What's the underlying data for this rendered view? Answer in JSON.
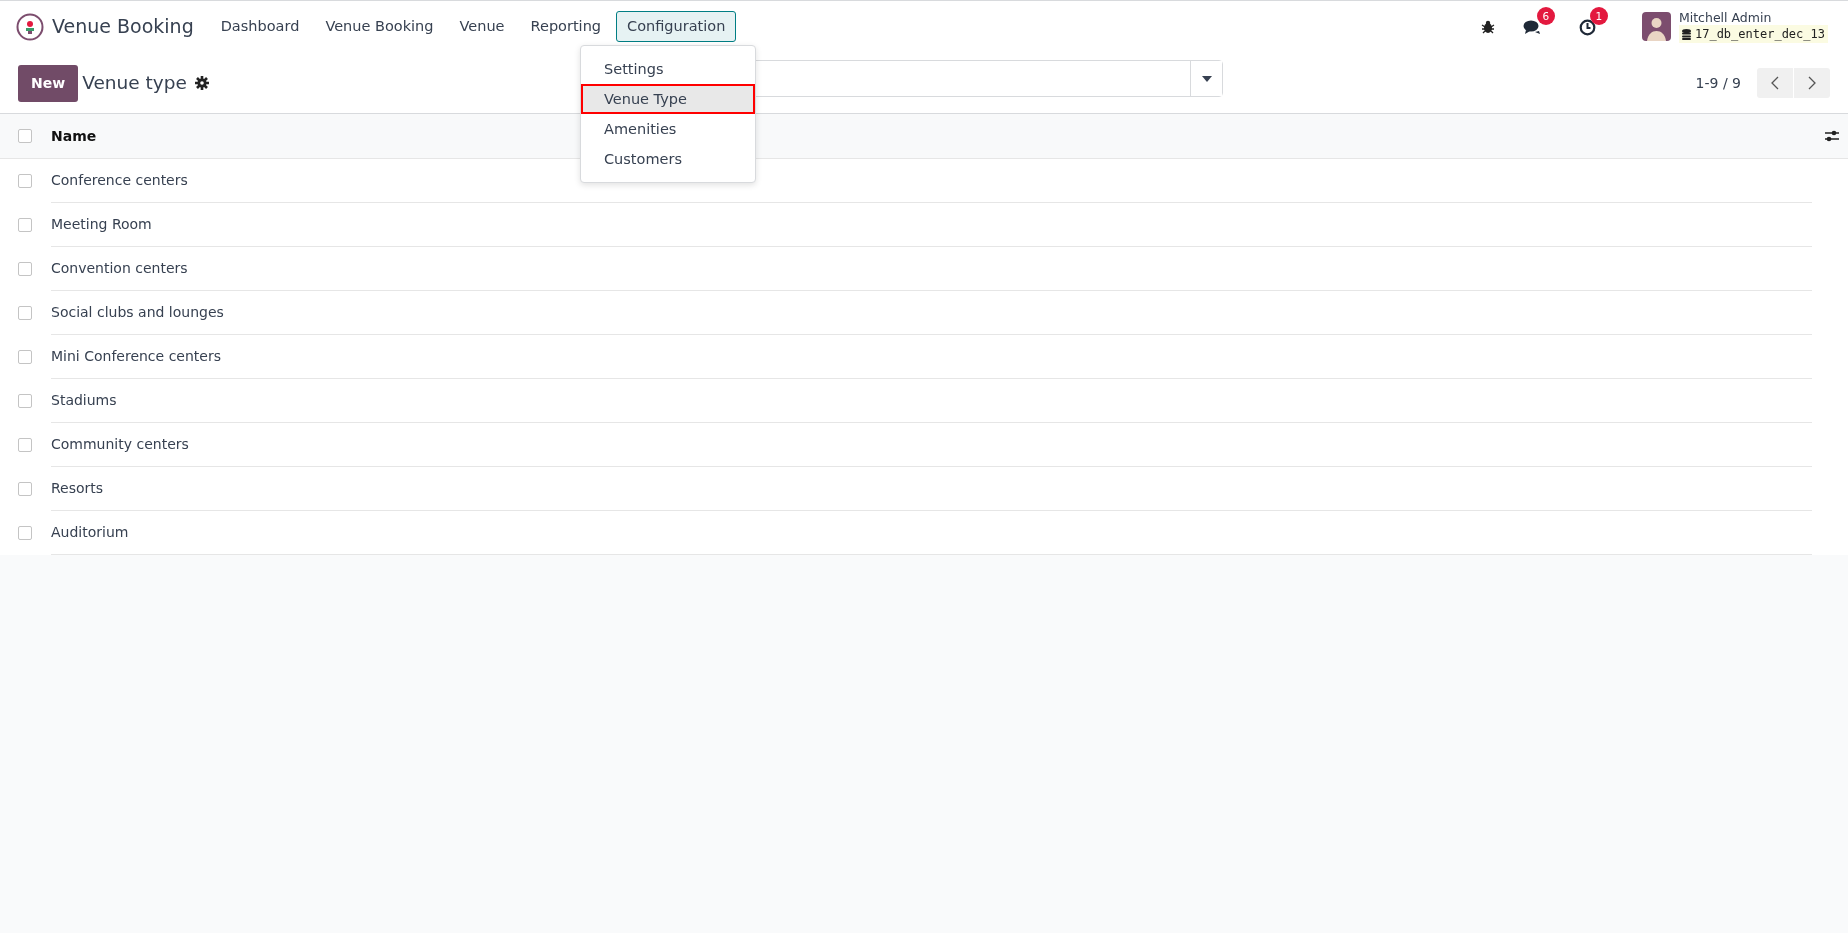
{
  "navbar": {
    "app_name": "Venue Booking",
    "menus": [
      {
        "label": "Dashboard",
        "selected": false
      },
      {
        "label": "Venue Booking",
        "selected": false
      },
      {
        "label": "Venue",
        "selected": false
      },
      {
        "label": "Reporting",
        "selected": false
      },
      {
        "label": "Configuration",
        "selected": true
      }
    ],
    "messages_badge": "6",
    "activities_badge": "1",
    "user_name": "Mitchell Admin",
    "database": "17_db_enter_dec_13"
  },
  "dropdown": {
    "items": [
      {
        "label": "Settings",
        "selected": false
      },
      {
        "label": "Venue Type",
        "selected": true
      },
      {
        "label": "Amenities",
        "selected": false
      },
      {
        "label": "Customers",
        "selected": false
      }
    ]
  },
  "control_panel": {
    "new_button": "New",
    "title": "Venue type",
    "pager": "1-9 / 9"
  },
  "table": {
    "columns": [
      {
        "label": "Name"
      }
    ],
    "header_checked": false,
    "rows": [
      {
        "name": "Conference centers",
        "checked": false
      },
      {
        "name": "Meeting Room",
        "checked": false
      },
      {
        "name": "Convention centers",
        "checked": false
      },
      {
        "name": "Social clubs and lounges",
        "checked": false
      },
      {
        "name": "Mini Conference centers",
        "checked": false
      },
      {
        "name": "Stadiums",
        "checked": false
      },
      {
        "name": "Community centers",
        "checked": false
      },
      {
        "name": "Resorts",
        "checked": false
      },
      {
        "name": "Auditorium",
        "checked": false
      }
    ]
  }
}
